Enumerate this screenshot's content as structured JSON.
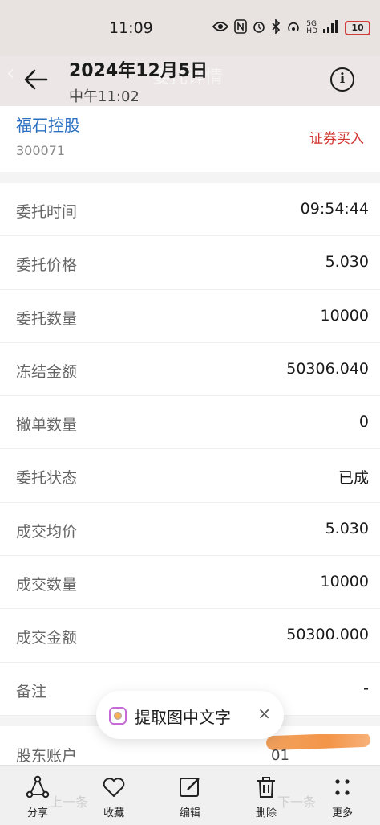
{
  "status_bar": {
    "time": "11:09",
    "signal_label_top": "5G",
    "signal_label_bottom": "HD",
    "battery": "10"
  },
  "header": {
    "date": "2024年12月5日",
    "time": "中午11:02",
    "ghost_title": "委托详情",
    "info_label": "i"
  },
  "stock": {
    "name": "福石控股",
    "code": "300071",
    "action": "证券买入",
    "action_color": "#d0342c",
    "name_color": "#2a6fc0"
  },
  "details": [
    {
      "label": "委托时间",
      "value": "09:54:44"
    },
    {
      "label": "委托价格",
      "value": "5.030"
    },
    {
      "label": "委托数量",
      "value": "10000"
    },
    {
      "label": "冻结金额",
      "value": "50306.040"
    },
    {
      "label": "撤单数量",
      "value": "0"
    },
    {
      "label": "委托状态",
      "value": "已成"
    },
    {
      "label": "成交均价",
      "value": "5.030"
    },
    {
      "label": "成交数量",
      "value": "10000"
    },
    {
      "label": "成交金额",
      "value": "50300.000"
    },
    {
      "label": "备注",
      "value": "-"
    }
  ],
  "account": {
    "label": "股东账户",
    "value_visible": "01"
  },
  "ocr_pill": {
    "label": "提取图中文字",
    "close": "×"
  },
  "bottom_bar": {
    "ghost_prev": "上一条",
    "ghost_next": "下一条",
    "tabs": [
      {
        "label": "分享",
        "icon": "share-icon"
      },
      {
        "label": "收藏",
        "icon": "heart-icon"
      },
      {
        "label": "编辑",
        "icon": "edit-icon"
      },
      {
        "label": "删除",
        "icon": "trash-icon"
      },
      {
        "label": "更多",
        "icon": "more-icon"
      }
    ]
  }
}
